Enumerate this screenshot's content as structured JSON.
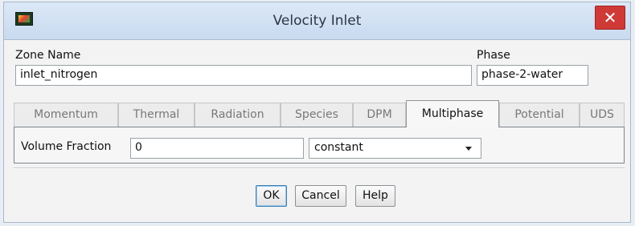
{
  "window": {
    "title": "Velocity Inlet",
    "close_glyph": "✕"
  },
  "zone": {
    "label": "Zone Name",
    "value": "inlet_nitrogen"
  },
  "phase": {
    "label": "Phase",
    "value": "phase-2-water"
  },
  "tabs": [
    {
      "label": "Momentum",
      "active": false
    },
    {
      "label": "Thermal",
      "active": false
    },
    {
      "label": "Radiation",
      "active": false
    },
    {
      "label": "Species",
      "active": false
    },
    {
      "label": "DPM",
      "active": false
    },
    {
      "label": "Multiphase",
      "active": true
    },
    {
      "label": "Potential",
      "active": false
    },
    {
      "label": "UDS",
      "active": false
    }
  ],
  "multiphase": {
    "volume_fraction_label": "Volume Fraction",
    "volume_fraction_value": "0",
    "method_selected": "constant"
  },
  "buttons": {
    "ok": "OK",
    "cancel": "Cancel",
    "help": "Help"
  },
  "icons": {
    "app": "fluent-app-icon",
    "close": "close-icon",
    "dropdown": "chevron-down-icon"
  },
  "colors": {
    "close_button": "#cf3a37",
    "titlebar": "#c9daf0"
  }
}
